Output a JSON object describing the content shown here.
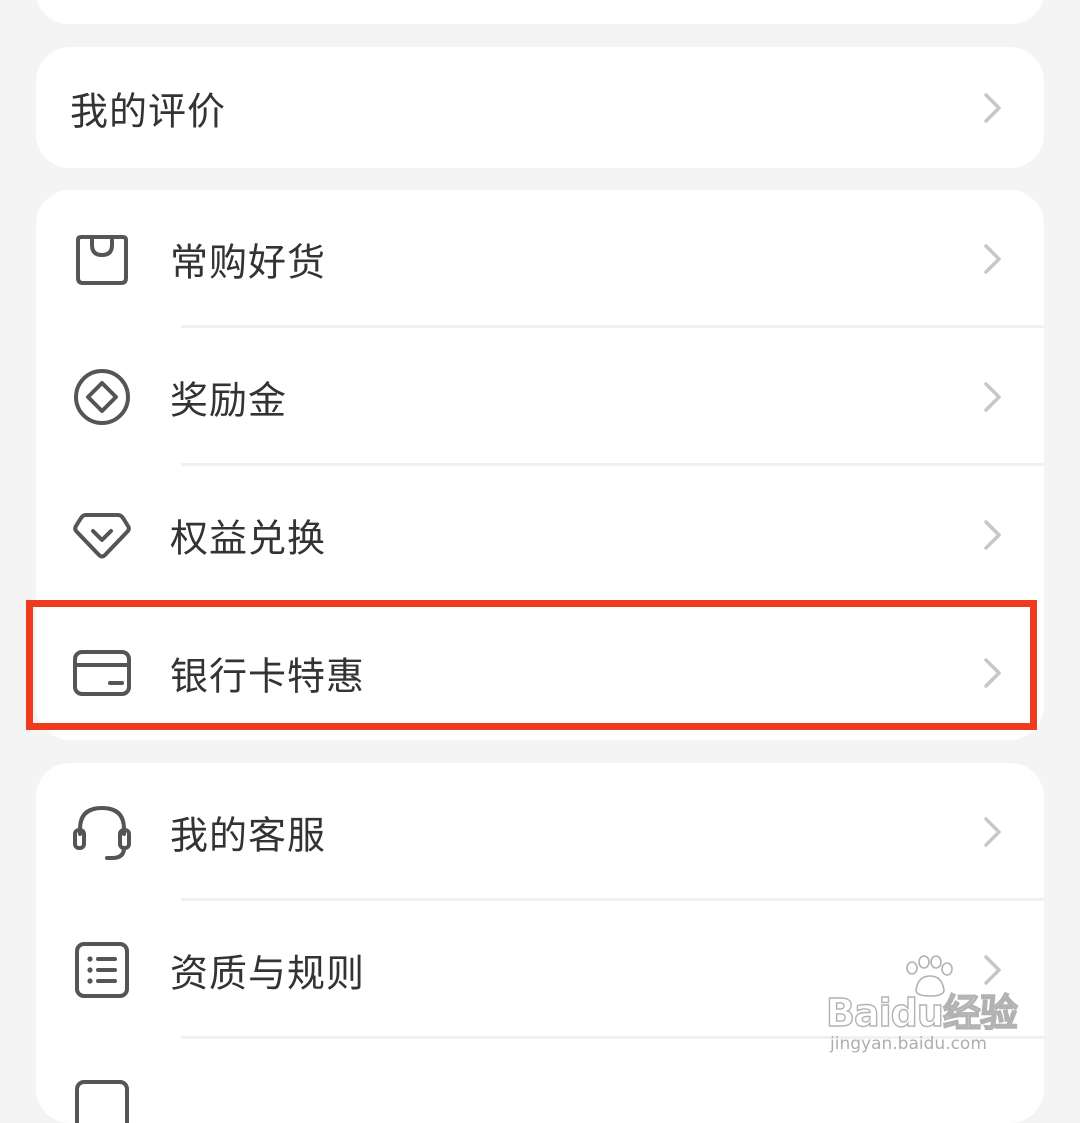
{
  "menu": {
    "review": {
      "label": "我的评价"
    },
    "shop_items": [
      {
        "label": "常购好货",
        "icon": "shopping-bag-icon"
      },
      {
        "label": "奖励金",
        "icon": "reward-coin-icon"
      },
      {
        "label": "权益兑换",
        "icon": "benefit-exchange-icon"
      },
      {
        "label": "银行卡特惠",
        "icon": "bank-card-icon",
        "highlighted": true
      }
    ],
    "service_items": [
      {
        "label": "我的客服",
        "icon": "headset-icon"
      },
      {
        "label": "资质与规则",
        "icon": "rules-list-icon"
      }
    ]
  },
  "annotation": {
    "highlight_color": "#f03a1e",
    "highlight_target": "银行卡特惠"
  },
  "watermark": {
    "brand": "Baidu经验",
    "url": "jingyan.baidu.com"
  },
  "colors": {
    "background": "#f4f4f4",
    "card": "#ffffff",
    "text": "#333333",
    "icon": "#555555",
    "chevron": "#c7c7c7"
  }
}
